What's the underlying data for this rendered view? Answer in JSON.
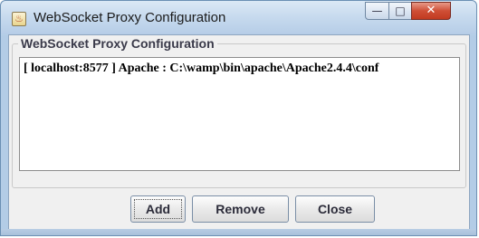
{
  "window": {
    "title": "WebSocket Proxy Configuration",
    "app_icon": "java-cup-icon",
    "controls": {
      "minimize_glyph": "—",
      "maximize_glyph": "□",
      "close_glyph": "✕"
    }
  },
  "group": {
    "title": "WebSocket Proxy Configuration"
  },
  "list": {
    "items": [
      "[ localhost:8577 ] Apache : C:\\wamp\\bin\\apache\\Apache2.4.4\\conf"
    ]
  },
  "buttons": {
    "add": "Add",
    "remove": "Remove",
    "close": "Close"
  },
  "colors": {
    "titlebar": "#c4d8ed",
    "close_button": "#cf4f36",
    "client_background": "#f0f0f0"
  }
}
